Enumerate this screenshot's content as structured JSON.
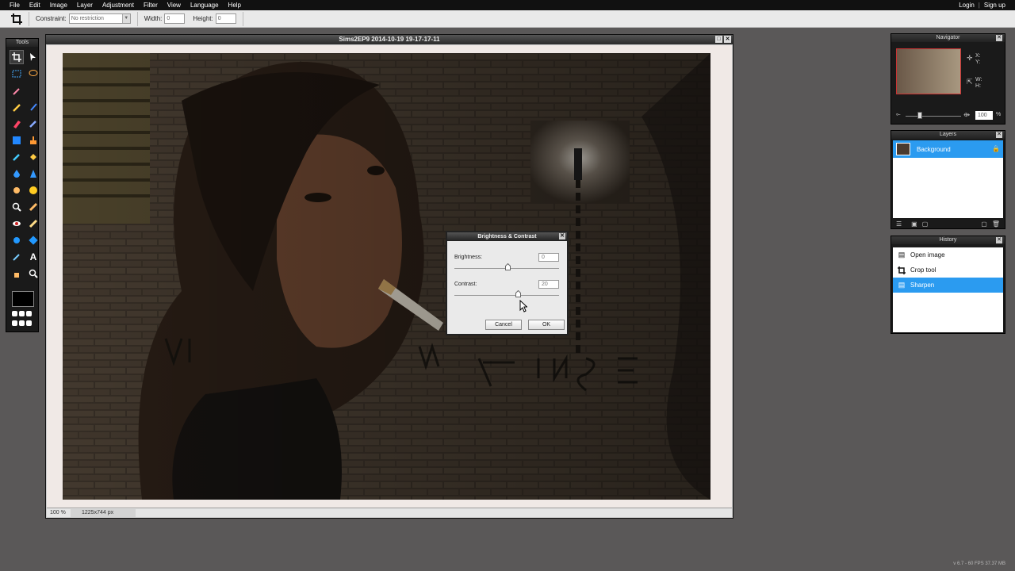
{
  "menubar": {
    "items": [
      "File",
      "Edit",
      "Image",
      "Layer",
      "Adjustment",
      "Filter",
      "View",
      "Language",
      "Help"
    ],
    "login": "Login",
    "divider": "|",
    "signup": "Sign up"
  },
  "options": {
    "constraint_label": "Constraint:",
    "constraint_value": "No restriction",
    "width_label": "Width:",
    "width_value": "0",
    "height_label": "Height:",
    "height_value": "0"
  },
  "tools": {
    "title": "Tools",
    "icons": [
      "crop-icon",
      "move-icon",
      "marquee-icon",
      "lasso-icon",
      "wand-icon",
      "",
      "pencil-icon",
      "brush-icon",
      "eraser-icon",
      "replace-color-icon",
      "gradient-icon",
      "clone-stamp-icon",
      "color-replace-icon",
      "fill-icon",
      "drop-icon",
      "sharpen-icon",
      "smudge-icon",
      "sponge-icon",
      "zoom-color-icon",
      "dodge-icon",
      "red-eye-icon",
      "spot-heal-icon",
      "bloat-icon",
      "pinch-icon",
      "picker-icon",
      "text-icon",
      "hand-icon",
      "zoom-icon"
    ]
  },
  "document": {
    "title": "Sims2EP9 2014-10-19 19-17-17-11",
    "zoom": "100 %",
    "dimensions": "1225x744 px"
  },
  "dialog": {
    "title": "Brightness & Contrast",
    "brightness_label": "Brightness:",
    "brightness_value": "0",
    "contrast_label": "Contrast:",
    "contrast_value": "20",
    "cancel": "Cancel",
    "ok": "OK"
  },
  "navigator": {
    "title": "Navigator",
    "x_label": "X:",
    "y_label": "Y:",
    "w_label": "W:",
    "h_label": "H:",
    "zoom_value": "100",
    "zoom_unit": "%"
  },
  "layers": {
    "title": "Layers",
    "items": [
      {
        "name": "Background"
      }
    ]
  },
  "history": {
    "title": "History",
    "items": [
      {
        "label": "Open image"
      },
      {
        "label": "Crop tool"
      },
      {
        "label": "Sharpen"
      }
    ]
  },
  "footer": "v 6.7 - 60 FPS 37.37 MB",
  "colors": {
    "accent": "#2b9bf0",
    "menubar": "#111111",
    "background": "#5a5858"
  }
}
